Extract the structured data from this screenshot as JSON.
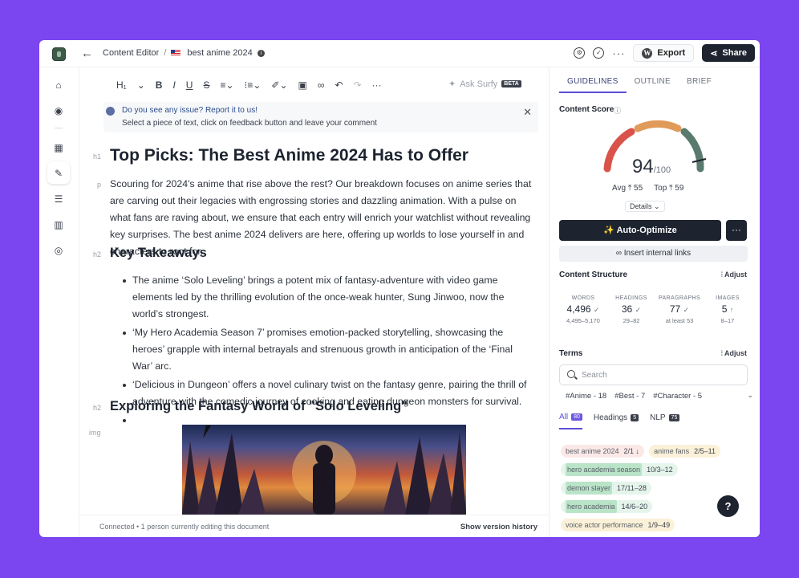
{
  "breadcrumb": {
    "app": "Content Editor",
    "separator": "/",
    "document": "best anime 2024"
  },
  "header": {
    "export_label": "Export",
    "share_label": "Share",
    "more": "···"
  },
  "toolbar": {
    "heading": "H₁",
    "ask_surfy": "Ask Surfy",
    "beta": "BETA",
    "more": "···"
  },
  "notice": {
    "title": "Do you see any issue? Report it to us!",
    "body": "Select a piece of text, click on feedback button and leave your comment",
    "close": "✕"
  },
  "editor": {
    "tags": {
      "h1": "h1",
      "p": "p",
      "h2": "h2",
      "img": "img"
    },
    "title": "Top Picks: The Best Anime 2024 Has to Offer",
    "intro": "Scouring for 2024's anime that rise above the rest? Our breakdown focuses on anime series that are carving out their legacies with engrossing stories and dazzling animation. With a pulse on what fans are raving about, we ensure that each entry will enrich your watchlist without revealing key surprises. The best anime 2024 delivers are here, offering up worlds to lose yourself in and characters to root for.",
    "h2_takeaways": "Key Takeaways",
    "bullets": [
      "The anime ‘Solo Leveling’ brings a potent mix of fantasy-adventure with video game elements led by the thrilling evolution of the once-weak hunter, Sung Jinwoo, now the world’s strongest.",
      "‘My Hero Academia Season 7’ promises emotion-packed storytelling, showcasing the heroes’ grapple with internal betrayals and strenuous growth in anticipation of the ‘Final War’ arc.",
      "‘Delicious in Dungeon’ offers a novel culinary twist on the fantasy genre, pairing the thrill of adventure with the comedic journey of cooking and eating dungeon monsters for survival."
    ],
    "h2_solo": "Exploring the Fantasy World of \"Solo Leveling\""
  },
  "status": {
    "connected": "Connected • 1 person currently editing this document",
    "history": "Show version history"
  },
  "panel": {
    "tabs": [
      "GUIDELINES",
      "OUTLINE",
      "BRIEF"
    ],
    "content_score_label": "Content Score",
    "score": "94",
    "score_max": "/100",
    "score_fraction": 0.94,
    "avg": "Avg ⸋ 55",
    "top": "Top ⸋ 59",
    "avg_label": "Avg",
    "avg_value": "55",
    "top_label": "Top",
    "top_value": "59",
    "details": "Details ⌄",
    "auto_optimize": "✨ Auto-Optimize",
    "more": "···",
    "internal_links": "Insert internal links",
    "structure_label": "Content Structure",
    "adjust": "Adjust",
    "stats": [
      {
        "label": "WORDS",
        "value": "4,496",
        "mark": "✓",
        "range": "4,495–5,170"
      },
      {
        "label": "HEADINGS",
        "value": "36",
        "mark": "✓",
        "range": "29–82"
      },
      {
        "label": "PARAGRAPHS",
        "value": "77",
        "mark": "✓",
        "range": "at least 53"
      },
      {
        "label": "IMAGES",
        "value": "5",
        "mark": "↑",
        "range": "8–17"
      }
    ],
    "terms_label": "Terms",
    "search_placeholder": "Search",
    "chips": [
      "#Anime - 18",
      "#Best - 7",
      "#Character - 5"
    ],
    "filter_tabs": [
      {
        "label": "All",
        "count": "80"
      },
      {
        "label": "Headings",
        "count": "5"
      },
      {
        "label": "NLP",
        "count": "75"
      }
    ],
    "terms": [
      {
        "name": "best anime 2024",
        "count": "2/1 ↓",
        "tone": "red"
      },
      {
        "name": "anime fans",
        "count": "2/5–11",
        "tone": "amb"
      },
      {
        "name": "hero academia season",
        "count": "10/3–12",
        "tone": "grn"
      },
      {
        "name": "demon slayer",
        "count": "17/11–28",
        "tone": "grn"
      },
      {
        "name": "hero academia",
        "count": "14/6–20",
        "tone": "grn"
      },
      {
        "name": "voice actor performance",
        "count": "1/9–49",
        "tone": "amb"
      }
    ],
    "help": "?"
  },
  "colors": {
    "background": "#7b45f0",
    "primary_dark": "#1d2430",
    "accent": "#5a4fd8"
  }
}
